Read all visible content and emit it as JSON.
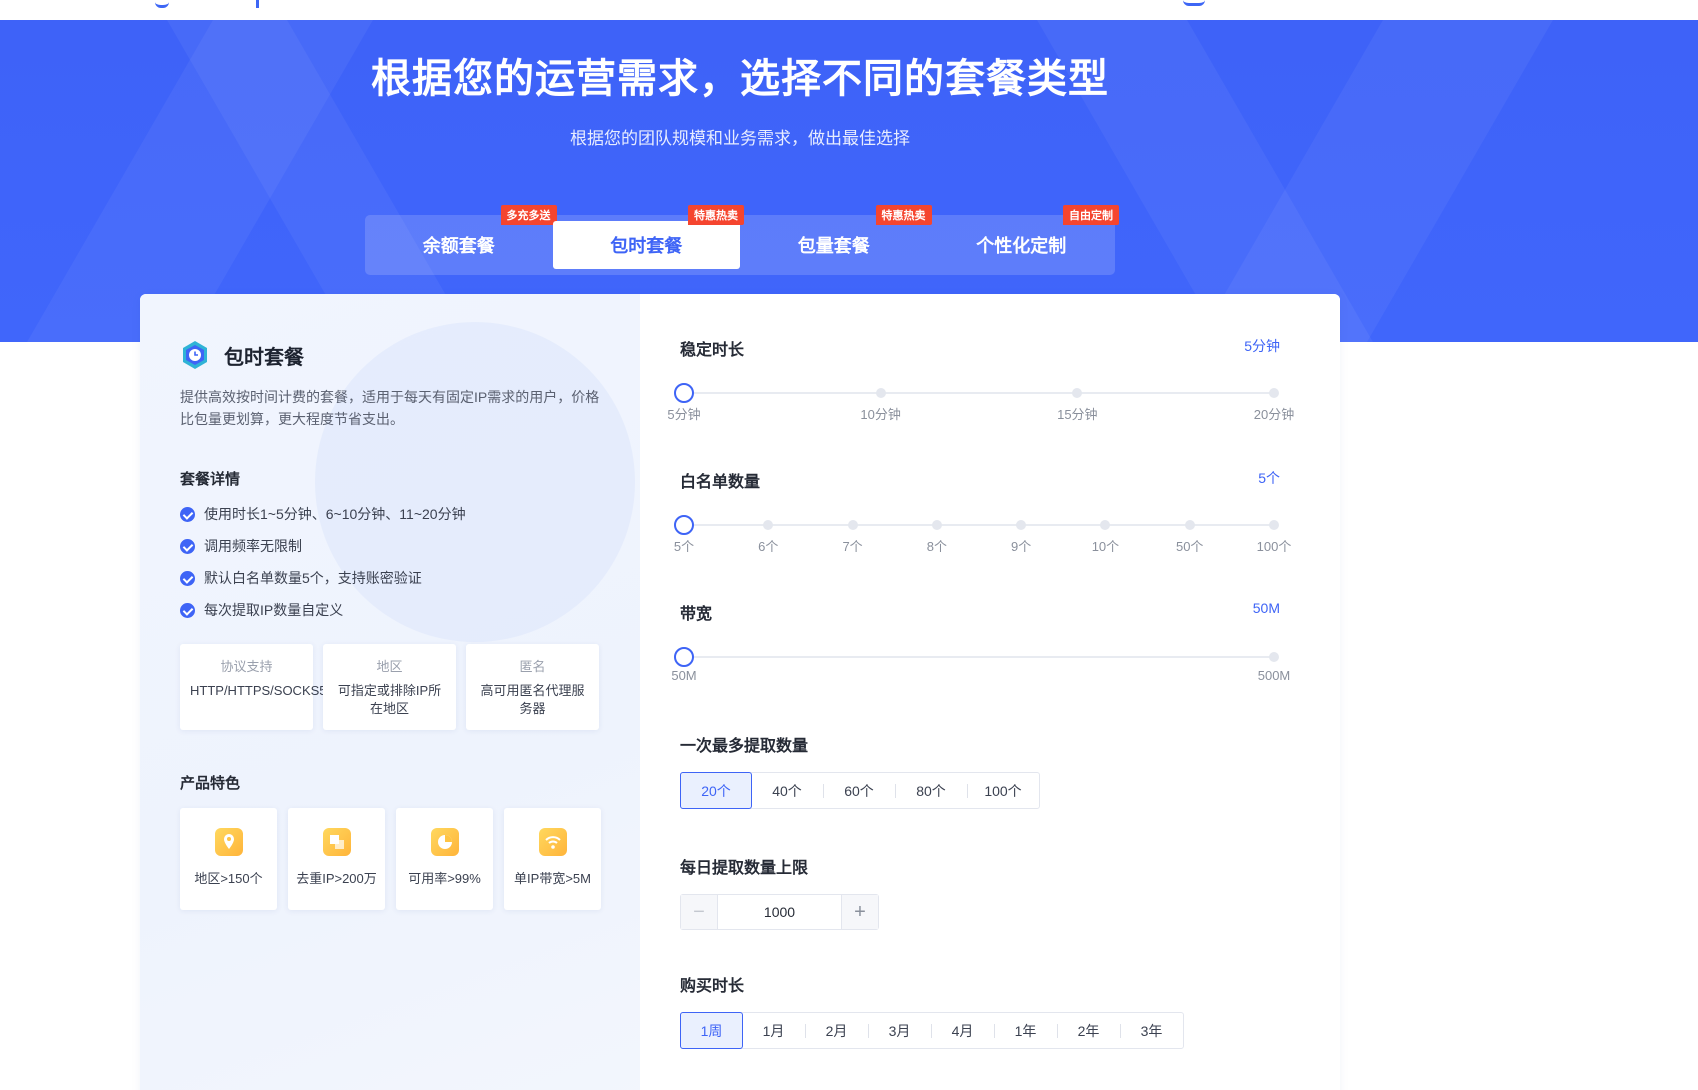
{
  "hero": {
    "title": "根据您的运营需求，选择不同的套餐类型",
    "subtitle": "根据您的团队规模和业务需求，做出最佳选择"
  },
  "tabs": [
    {
      "label": "余额套餐",
      "tag": "多充多送",
      "active": false
    },
    {
      "label": "包时套餐",
      "tag": "特惠热卖",
      "active": true
    },
    {
      "label": "包量套餐",
      "tag": "特惠热卖",
      "active": false
    },
    {
      "label": "个性化定制",
      "tag": "自由定制",
      "active": false
    }
  ],
  "plan": {
    "name": "包时套餐",
    "description": "提供高效按时间计费的套餐，适用于每天有固定IP需求的用户，价格比包量更划算，更大程度节省支出。",
    "details_title": "套餐详情",
    "details": [
      "使用时长1~5分钟、6~10分钟、11~20分钟",
      "调用频率无限制",
      "默认白名单数量5个，支持账密验证",
      "每次提取IP数量自定义"
    ],
    "info": [
      {
        "label": "协议支持",
        "value": "HTTP/HTTPS/SOCKS5"
      },
      {
        "label": "地区",
        "value": "可指定或排除IP所在地区"
      },
      {
        "label": "匿名",
        "value": "高可用匿名代理服务器"
      }
    ],
    "features_title": "产品特色",
    "features": [
      {
        "icon": "location-pin-icon",
        "label": "地区>150个"
      },
      {
        "icon": "dedupe-icon",
        "label": "去重IP>200万"
      },
      {
        "icon": "pie-chart-icon",
        "label": "可用率>99%"
      },
      {
        "icon": "wifi-icon",
        "label": "单IP带宽>5M"
      }
    ]
  },
  "config": {
    "duration": {
      "label": "稳定时长",
      "value": "5分钟",
      "stops": [
        "5分钟",
        "10分钟",
        "15分钟",
        "20分钟"
      ],
      "selected_index": 0
    },
    "whitelist": {
      "label": "白名单数量",
      "value": "5个",
      "stops": [
        "5个",
        "6个",
        "7个",
        "8个",
        "9个",
        "10个",
        "50个",
        "100个"
      ],
      "selected_index": 0
    },
    "bandwidth": {
      "label": "带宽",
      "value": "50M",
      "stops": [
        "50M",
        "500M"
      ],
      "selected_index": 0
    },
    "max_extract": {
      "label": "一次最多提取数量",
      "options": [
        "20个",
        "40个",
        "60个",
        "80个",
        "100个"
      ],
      "selected_index": 0
    },
    "daily_limit": {
      "label": "每日提取数量上限",
      "value": "1000",
      "minus": "−",
      "plus": "+"
    },
    "purchase_duration": {
      "label": "购买时长",
      "options": [
        "1周",
        "1月",
        "2月",
        "3月",
        "4月",
        "1年",
        "2年",
        "3年"
      ],
      "selected_index": 0
    }
  },
  "colors": {
    "primary": "#3e64f6",
    "tag": "#f5452f",
    "feature": "#ffc443"
  }
}
